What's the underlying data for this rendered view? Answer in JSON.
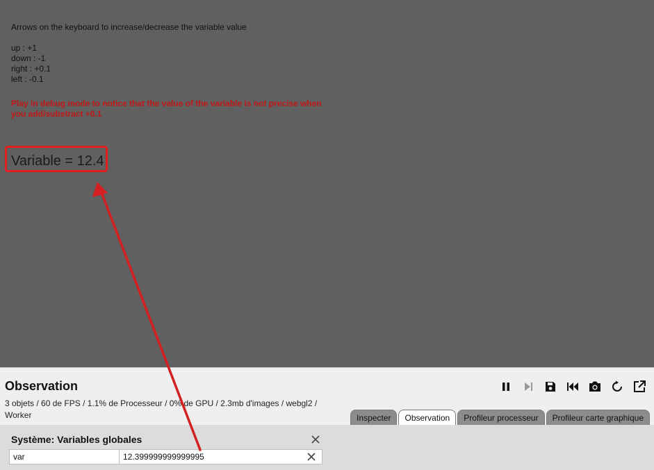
{
  "game": {
    "instructions": [
      "Arrows on the keyboard to increase/decrease the variable value",
      "",
      "up : +1",
      "down : -1",
      "right : +0.1",
      "left : -0.1"
    ],
    "warning": "Play in debug mode to notice that the value of the variable is not precise when you add/substract +0.1",
    "variable_display": "Variable = 12.4"
  },
  "debugger": {
    "title": "Observation",
    "stats": "3 objets / 60 de FPS / 1.1% de Processeur / 0% de GPU / 2.3mb d'images / webgl2 / Worker",
    "toolbar": [
      "pause-icon",
      "step-icon",
      "save-icon",
      "skip-back-icon",
      "camera-icon",
      "reload-icon",
      "external-link-icon"
    ],
    "tabs": [
      {
        "label": "Inspecter",
        "active": false
      },
      {
        "label": "Observation",
        "active": true
      },
      {
        "label": "Profileur processeur",
        "active": false
      },
      {
        "label": "Profileur carte graphique",
        "active": false
      }
    ],
    "watch": {
      "title": "Système: Variables globales",
      "name": "var",
      "value": "12.399999999999995"
    }
  },
  "colors": {
    "background": "#606060",
    "warning": "#c01818",
    "highlight": "#e02020"
  }
}
